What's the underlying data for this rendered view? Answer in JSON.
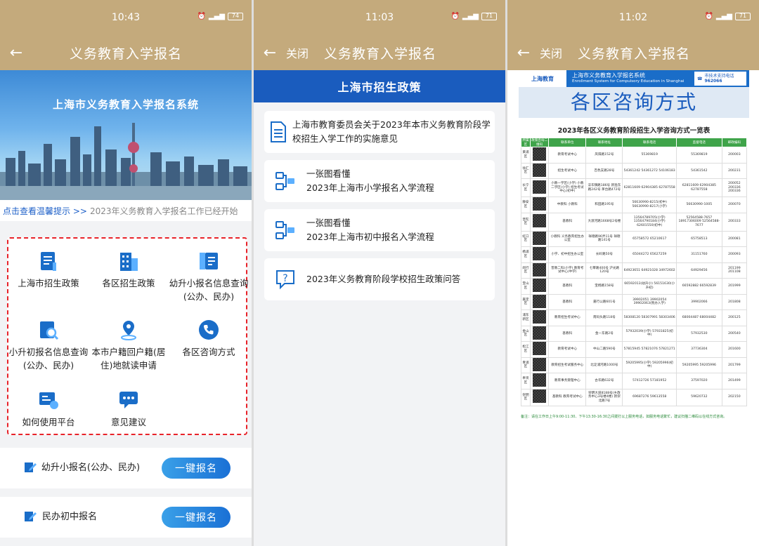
{
  "panel1": {
    "status": {
      "time": "10:43",
      "battery": "74"
    },
    "nav": {
      "title": "义务教育入学报名"
    },
    "banner": {
      "title": "上海市义务教育入学报名系统"
    },
    "notice": {
      "link": "点击查看温馨提示 >>",
      "text": "2023年义务教育入学报名工作已经开始"
    },
    "grid": [
      {
        "label": "上海市招生政策"
      },
      {
        "label": "各区招生政策"
      },
      {
        "label": "幼升小报名信息查询(公办、民办)"
      },
      {
        "label": "小升初报名信息查询(公办、民办)"
      },
      {
        "label": "本市户籍回户籍(居住)地就读申请"
      },
      {
        "label": "各区咨询方式"
      },
      {
        "label": "如何使用平台"
      },
      {
        "label": "意见建议"
      }
    ],
    "rows": [
      {
        "label": "幼升小报名(公办、民办)",
        "button": "一键报名"
      },
      {
        "label": "民办初中报名",
        "button": "一键报名"
      }
    ]
  },
  "panel2": {
    "status": {
      "time": "11:03",
      "battery": "71"
    },
    "nav": {
      "close": "关闭",
      "title": "义务教育入学报名"
    },
    "header": "上海市招生政策",
    "cards": [
      {
        "text": "上海市教育委员会关于2023年本市义务教育阶段学校招生入学工作的实施意见"
      },
      {
        "line1": "一张图看懂",
        "line2": "2023年上海市小学报名入学流程"
      },
      {
        "line1": "一张图看懂",
        "line2": "2023年上海市初中报名入学流程"
      },
      {
        "text": "2023年义务教育阶段学校招生政策问答"
      }
    ]
  },
  "panel3": {
    "status": {
      "time": "11:02",
      "battery": "71"
    },
    "nav": {
      "close": "关闭",
      "title": "义务教育入学报名"
    },
    "logo": "上海教育",
    "system": "上海市义务教育入学报名系统",
    "system_en": "Enrollment System for Compulsory Education in Shanghai",
    "tel_label": "市技术支持电话",
    "tel": "962066",
    "big_title": "各区咨询方式",
    "table_title": "2023年各区义务教育阶段招生入学咨询方式一览表",
    "columns": [
      "所属区",
      "政策咨询二维码",
      "联系单位",
      "联系地址",
      "联系电话",
      "监督电话",
      "邮政编码"
    ],
    "rows": [
      [
        "黄浦区",
        "",
        "教育考试中心",
        "凤阳路152号",
        "55369819",
        "55369819",
        "200003"
      ],
      [
        "徐汇区",
        "",
        "招生考试中心",
        "百色支路28号",
        "54361242 54361272 54106183",
        "54361542",
        "200231"
      ],
      [
        "长宁区",
        "",
        "小教一学区(小学) 小教二学区(小学) 招生考试中心(初中)",
        "法华镇路186号 新渔东路242号 茅台路472号",
        "62811609 62904385 62787558",
        "62811609 62904385 62787558",
        "200052 200336 200336"
      ],
      [
        "静安区",
        "",
        "中教科 小教科",
        "和田路195号",
        "56630990-8215(初中) 56630990-8217(小学)",
        "56630990-1005",
        "200070"
      ],
      [
        "普陀区",
        "",
        "基教科",
        "大渡河路1668号2号楼",
        "13564789705(小学) 13564790184(小学) 62601550(初中)",
        "52564588-7657 18917306009 52564588-7677",
        "200333"
      ],
      [
        "虹口区",
        "",
        "小教科 义务教育招生办公室",
        "祥德路96弄11号 祥德路141号",
        "65758572 65210617",
        "65758513",
        "200081"
      ],
      [
        "杨浦区",
        "",
        "小学、初中招生办公室",
        "长岭路50号",
        "65044272 65627259",
        "31151760",
        "200093"
      ],
      [
        "闵行区",
        "",
        "普教二科(小学) 教育考试中心(中学)",
        "七莘路400号 沪光路120号",
        "64923651 64921028 34972602",
        "64929456",
        "201199 201108"
      ],
      [
        "宝山区",
        "",
        "基教科",
        "宝杨路158号",
        "66592013(幼升小) 56151630(小升初)",
        "66592882 66592839",
        "201999"
      ],
      [
        "嘉定区",
        "",
        "基教科",
        "嘉行公路601号",
        "39902051 39902054 39902063(民办入学)",
        "39902066",
        "201808"
      ],
      [
        "浦东新区",
        "",
        "教育招生考试中心",
        "南码头路118号",
        "58308120 58307991 58303406",
        "68004487 68004482",
        "200125"
      ],
      [
        "金山区",
        "",
        "基教科",
        "金一东路2号",
        "57932039(小学) 57931825(初中)",
        "57932530",
        "200540"
      ],
      [
        "松江区",
        "",
        "教育考试中心",
        "中山二路590号",
        "57815945 57821076 57821271",
        "37736304",
        "201600"
      ],
      [
        "青浦区",
        "",
        "教育招生考试服务中心",
        "北淀浦河路1000号",
        "59205995(小学) 59205996(初中)",
        "59205995 59205996",
        "201799"
      ],
      [
        "奉贤区",
        "",
        "教育事务受理中心",
        "古华路632号",
        "57412726 57181952",
        "37597020",
        "201499"
      ],
      [
        "崇明区",
        "",
        "基教科 教育考试中心",
        "崇明大道8188号(乡政务中心3号楼4楼) 新崇北路7号",
        "69687276 59613558",
        "59620732",
        "202150"
      ]
    ],
    "note": "备注：请在工作日上午9:00-11:30、下午13:30-16:30之间拨打以上服务电话，如服务电话繁忙，建议扫描二维码以在线方式咨询。"
  }
}
